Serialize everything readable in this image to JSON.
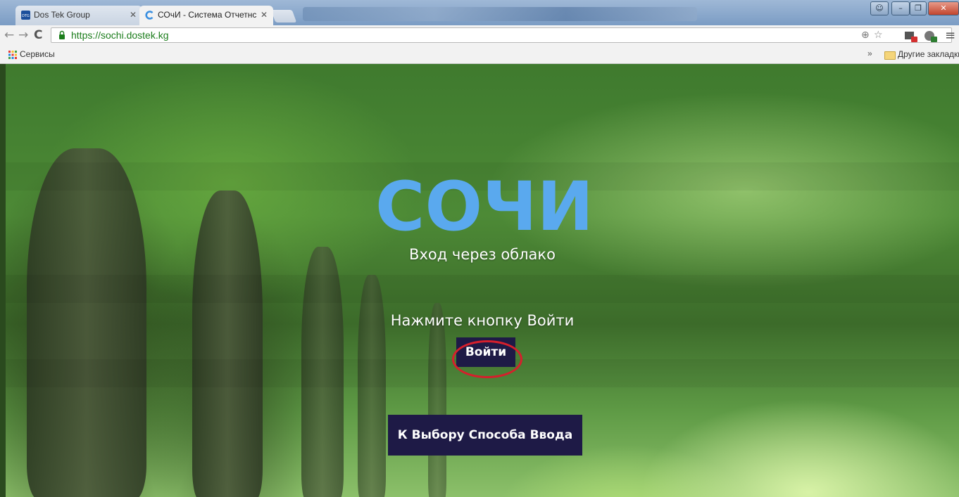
{
  "browser": {
    "tabs": [
      {
        "title": "Dos Tek Group",
        "favicon": "dtg-favicon-icon",
        "active": false
      },
      {
        "title": "СОчИ - Система Отчетнс",
        "favicon": "sochi-favicon-icon",
        "active": true
      }
    ],
    "url": "https://sochi.dostek.kg",
    "bookmarks_bar": {
      "apps_label": "Сервисы",
      "more": "»",
      "other_bookmarks_label": "Другие закладки"
    },
    "colors": {
      "url_secure": "#1c7d1c",
      "window_close": "#c2452d"
    }
  },
  "page": {
    "logo_text": "СОЧИ",
    "logo_color": "#5aa9ee",
    "subtitle": "Вход через облако",
    "prompt": "Нажмите кнопку Войти",
    "login_button": "Войти",
    "back_button": "К Выбору Способа Ввода",
    "button_color": "#1e1a46",
    "highlight_color": "#d61f2c"
  }
}
